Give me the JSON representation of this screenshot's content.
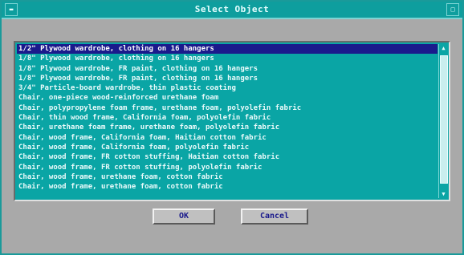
{
  "window": {
    "title": "Select Object"
  },
  "list": {
    "items": [
      "1/2\" Plywood wardrobe, clothing on 16 hangers",
      "1/8\" Plywood wardrobe, clothing on 16 hangers",
      "1/8\" Plywood wardrobe, FR paint, clothing on 16 hangers",
      "1/8\" Plywood wardrobe, FR paint, clothing on 16 hangers",
      "3/4\" Particle-board wardrobe, thin plastic coating",
      "Chair, one-piece wood-reinforced urethane foam",
      "Chair, polypropylene foam frame, urethane foam, polyolefin fabric",
      "Chair, thin wood frame, California foam, polyolefin fabric",
      "Chair, urethane foam frame, urethane foam, polyolefin fabric",
      "Chair, wood frame, California foam, Haitian cotton fabric",
      "Chair, wood frame, California foam, polyolefin fabric",
      "Chair, wood frame, FR cotton stuffing, Haitian cotton fabric",
      "Chair, wood frame, FR cotton stuffing, polyolefin fabric",
      "Chair, wood frame, urethane foam, cotton fabric",
      "Chair, wood frame, urethane foam, cotton fabric"
    ],
    "selected_index": 0
  },
  "buttons": {
    "ok": "OK",
    "cancel": "Cancel"
  },
  "icons": {
    "window_menu": "window-menu-icon",
    "maximize": "maximize-icon",
    "scroll_up": "scroll-up-arrow-icon",
    "scroll_down": "scroll-down-arrow-icon"
  },
  "colors": {
    "titlebar": "#0e9e9e",
    "list_background": "#0aa5a5",
    "selection": "#1a1a8c",
    "dialog_background": "#a9a9a9"
  }
}
